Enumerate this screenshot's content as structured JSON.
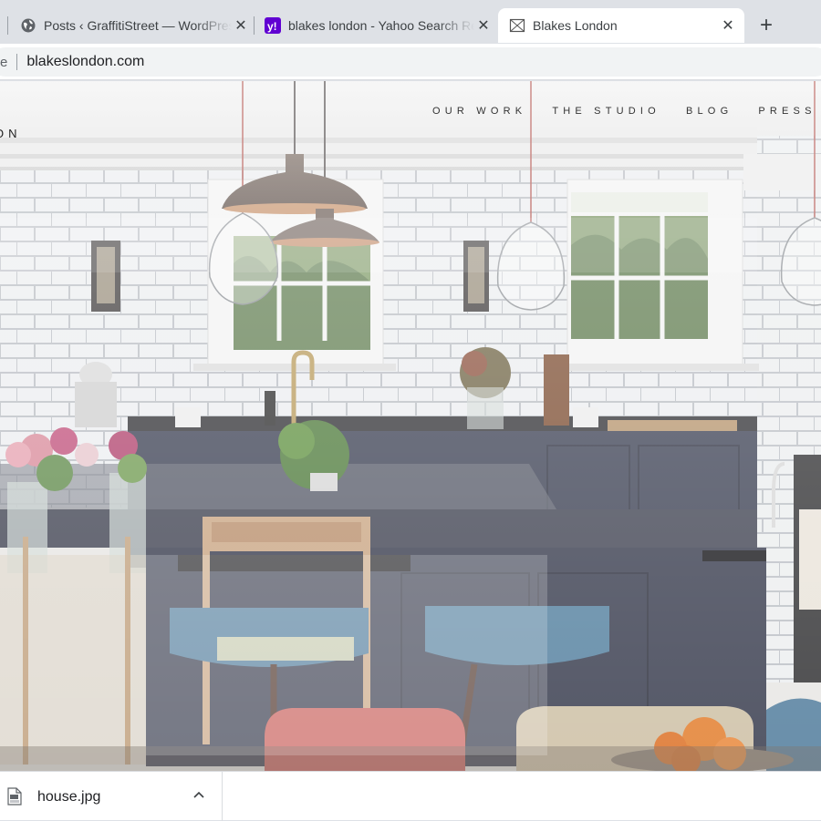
{
  "browser": {
    "tabs": [
      {
        "title": "Posts ‹ GraffitiStreet — WordPress",
        "icon": "globe-icon",
        "active": false
      },
      {
        "title": "blakes london - Yahoo Search Results",
        "icon": "yahoo-icon",
        "active": false
      },
      {
        "title": "Blakes London",
        "icon": "blakes-favicon-icon",
        "active": true
      }
    ],
    "new_tab_label": "+",
    "close_glyph": "✕",
    "address_bar": {
      "security_text": "e",
      "url": "blakeslondon.com"
    }
  },
  "page": {
    "brand_partial": "ON",
    "nav": [
      "OUR WORK",
      "THE STUDIO",
      "BLOG",
      "PRESS"
    ],
    "hero_image": "kitchen-photo"
  },
  "downloads": {
    "items": [
      {
        "filename": "house.jpg",
        "icon": "jpeg-file-icon"
      }
    ],
    "caret_icon": "chevron-up-icon"
  },
  "colors": {
    "tabstrip_bg": "#dee1e6",
    "active_tab_bg": "#ffffff",
    "omnibox_bg": "#f1f3f4",
    "yahoo_purple": "#6001d2",
    "cabinet_navy": "#33384a",
    "stool_blue": "#5b87a6"
  }
}
